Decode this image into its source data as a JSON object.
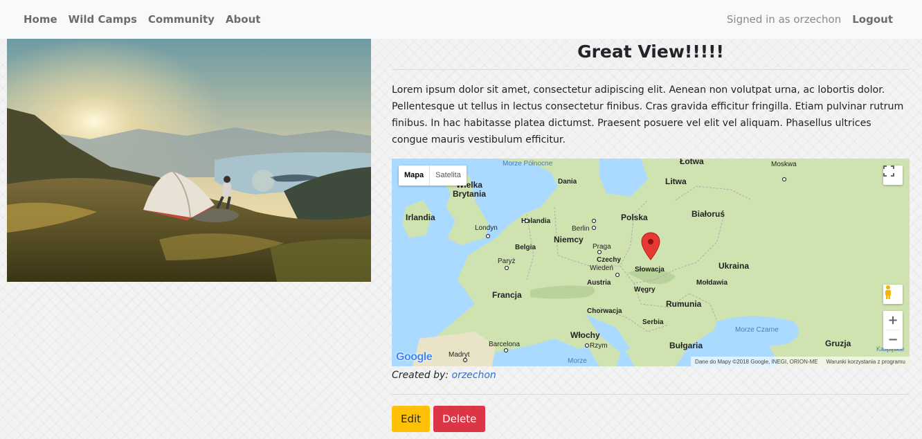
{
  "nav": {
    "links": [
      "Home",
      "Wild Camps",
      "Community",
      "About"
    ],
    "signed_in": "Signed in as orzechon",
    "logout": "Logout"
  },
  "camp": {
    "title": "Great View!!!!!",
    "description": "Lorem ipsum dolor sit amet, consectetur adipiscing elit. Aenean non volutpat urna, ac lobortis dolor. Pellentesque ut tellus in lectus consectetur finibus. Cras gravida efficitur fringilla. Etiam pulvinar rutrum finibus. In hac habitasse platea dictumst. Praesent posuere vel elit vel aliquam. Phasellus ultrices congue mauris vestibulum efficitur.",
    "created_by_label": "Created by:",
    "author": "orzechon",
    "edit_label": "Edit",
    "delete_label": "Delete"
  },
  "map": {
    "type_map": "Mapa",
    "type_satellite": "Satelita",
    "attribution": "Dane do Mapy ©2018 Google, INEGI, ORION-ME",
    "terms": "Warunki korzystania z programu",
    "google": "Google",
    "zoom_in": "+",
    "zoom_out": "−",
    "labels": {
      "morze_polnocne": "Morze Północne",
      "wielka_brytania": "Wielka Brytania",
      "irlandia": "Irlandia",
      "londyn": "Londyn",
      "dania": "Dania",
      "holandia": "Holandia",
      "berlin": "Berlin",
      "niemcy": "Niemcy",
      "polska": "Polska",
      "litwa": "Litwa",
      "lotwa": "Łotwa",
      "moskwa": "Moskwa",
      "bialorus": "Białoruś",
      "belgia": "Belgia",
      "paryz": "Paryż",
      "praga": "Praga",
      "czechy": "Czechy",
      "wieden": "Wiedeń",
      "austria": "Austria",
      "slowacja": "Słowacja",
      "ukraina": "Ukraina",
      "moldawia": "Mołdawia",
      "francja": "Francja",
      "wegry": "Węgry",
      "rumunia": "Rumunia",
      "chorwacja": "Chorwacja",
      "serbia": "Serbia",
      "wlochy": "Włochy",
      "bulgaria": "Bułgaria",
      "morze_czarne": "Morze Czarne",
      "gruzja": "Gruzja",
      "barcelona": "Barcelona",
      "madryt": "Madryt",
      "rzym": "Rzym",
      "morze": "Morze",
      "kaspijskie": "Kaspijskie"
    }
  }
}
